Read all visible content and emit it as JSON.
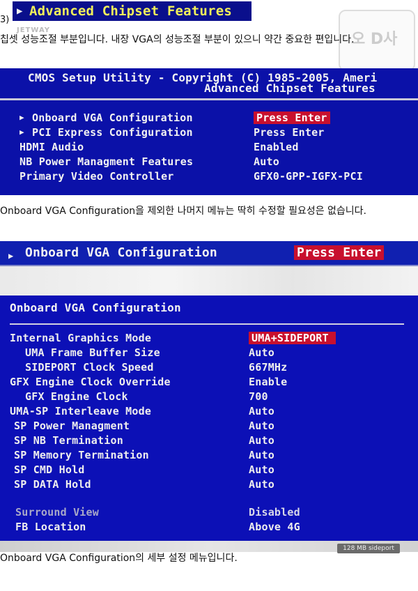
{
  "step_number": "3)",
  "top_banner": {
    "arrow": "▶",
    "title": "Advanced Chipset Features"
  },
  "watermark": {
    "brand": "JETWAY",
    "text": "오 D사"
  },
  "intro_text": "칩셋 성능조절 부분입니다. 내장 VGA의 성능조절 부분이 있으니 약간 중요한 편입니다.",
  "panel1": {
    "header_line1": "CMOS Setup Utility - Copyright (C) 1985-2005, Ameri",
    "header_line2": "Advanced Chipset Features",
    "items": [
      {
        "arrow": "▶",
        "label": "Onboard VGA Configuration",
        "value": "Press Enter"
      },
      {
        "arrow": "▶",
        "label": "PCI Express Configuration",
        "value": "Press Enter"
      },
      {
        "arrow": "",
        "label": "HDMI Audio",
        "value": "Enabled"
      },
      {
        "arrow": "",
        "label": "NB Power Managment Features",
        "value": "Auto"
      },
      {
        "arrow": "",
        "label": "Primary Video Controller",
        "value": "GFX0-GPP-IGFX-PCI"
      }
    ]
  },
  "mid_text": "Onboard VGA Configuration을 제외한 나머지 메뉴는 딱히 수정할 필요성은 없습니다.",
  "panel2": {
    "arrow": "▶",
    "label": "Onboard VGA Configuration",
    "value": "Press Enter"
  },
  "panel3": {
    "title": "Onboard VGA Configuration",
    "items": [
      {
        "label": "Internal Graphics Mode",
        "value": "UMA+SIDEPORT"
      },
      {
        "label": "UMA Frame Buffer Size",
        "value": "Auto"
      },
      {
        "label": "SIDEPORT Clock Speed",
        "value": "667MHz"
      },
      {
        "label": "GFX Engine Clock Override",
        "value": "Enable"
      },
      {
        "label": "GFX Engine Clock",
        "value": "700"
      },
      {
        "label": "UMA-SP Interleave Mode",
        "value": "Auto"
      },
      {
        "label": "SP Power Managment",
        "value": "Auto"
      },
      {
        "label": "SP NB Termination",
        "value": "Auto"
      },
      {
        "label": "SP Memory Termination",
        "value": "Auto"
      },
      {
        "label": "SP CMD Hold",
        "value": "Auto"
      },
      {
        "label": "SP DATA Hold",
        "value": "Auto"
      },
      {
        "label": "Surround View",
        "value": "Disabled"
      },
      {
        "label": "FB Location",
        "value": "Above 4G"
      }
    ]
  },
  "bottom_badge": "128 MB sideport",
  "detail_caption": "Onboard VGA Configuration의 세부 설정 메뉴입니다.",
  "colors": {
    "bios_blue": "#0b11a8",
    "highlight_red": "#c8102e",
    "banner_yellow": "#f2f05a"
  }
}
